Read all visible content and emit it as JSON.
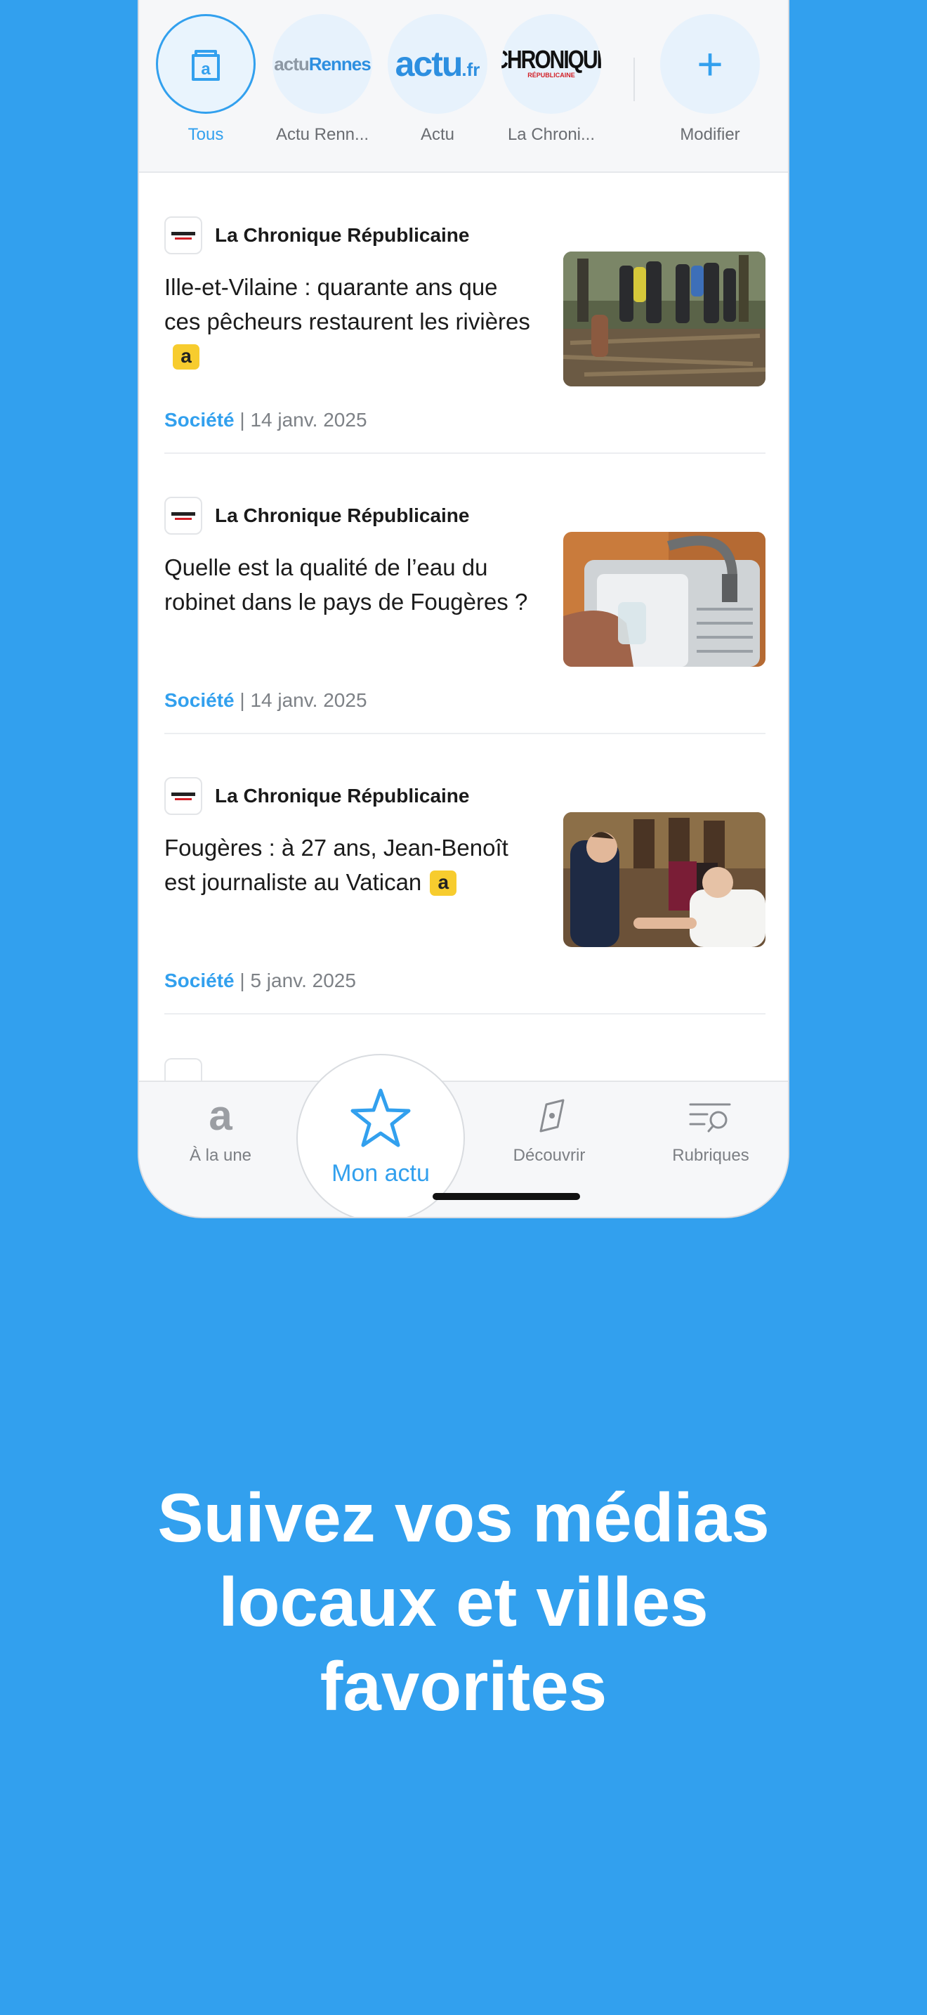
{
  "sources": {
    "items": [
      {
        "label": "Tous",
        "logo": "a"
      },
      {
        "label": "Actu Renn...",
        "logo_a": "actu",
        "logo_b": "Rennes"
      },
      {
        "label": "Actu",
        "logo_a": "actu",
        "logo_b": ".fr"
      },
      {
        "label": "La Chroni...",
        "logo_a": "CHRONIQUE",
        "logo_b": "RÉPUBLICAINE"
      }
    ],
    "edit": {
      "label": "Modifier",
      "icon": "+"
    }
  },
  "articles": [
    {
      "source": "La Chronique Républicaine",
      "title": "Ille-et-Vilaine : quarante ans que ces pêcheurs restaurent les rivières",
      "premium": true,
      "premium_badge": "a",
      "category": "Société",
      "separator": "|",
      "date": "14 janv. 2025"
    },
    {
      "source": "La Chronique Républicaine",
      "title": "Quelle est la qualité de l’eau du robinet dans le pays de Fougères ?",
      "premium": false,
      "category": "Société",
      "separator": "|",
      "date": "14 janv. 2025"
    },
    {
      "source": "La Chronique Républicaine",
      "title": "Fougères : à 27 ans, Jean-Benoît est journaliste au Vatican",
      "premium": true,
      "premium_badge": "a",
      "category": "Société",
      "separator": "|",
      "date": "5 janv. 2025"
    }
  ],
  "tabbar": {
    "home": {
      "label": "À la une",
      "icon": "a"
    },
    "mine": {
      "label": "Mon actu"
    },
    "discover": {
      "label": "Découvrir"
    },
    "sections": {
      "label": "Rubriques"
    }
  },
  "headline": "Suivez vos médias locaux et villes favorites",
  "colors": {
    "accent": "#32a0ee",
    "background": "#32a0ee",
    "badge": "#f7cc2e"
  }
}
